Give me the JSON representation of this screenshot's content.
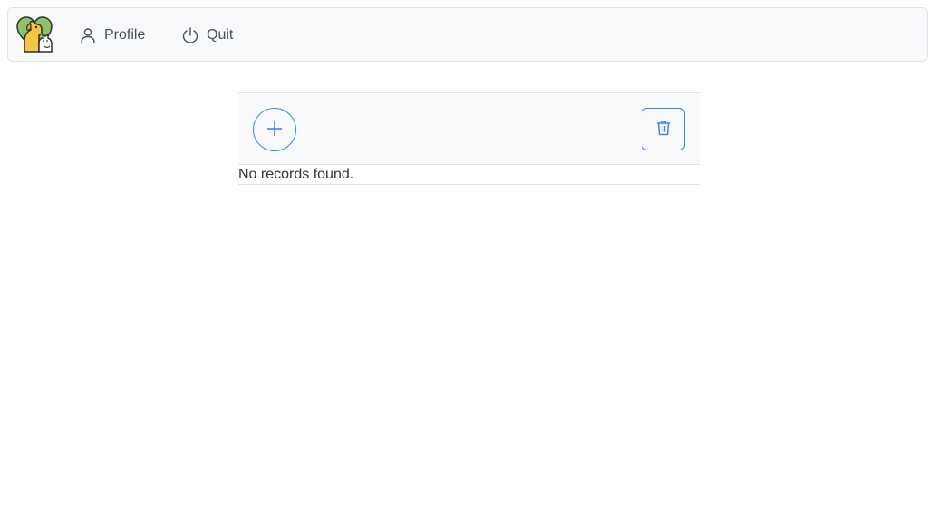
{
  "topbar": {
    "logo": {
      "icon": "dog-cat-logo-icon",
      "colors": {
        "heart": "#8fc06a",
        "dog": "#f4c542",
        "cat": "#ffffff"
      }
    },
    "menu": [
      {
        "label": "Profile",
        "icon": "user-icon"
      },
      {
        "label": "Quit",
        "icon": "power-icon"
      }
    ]
  },
  "table": {
    "toolbar": {
      "add_icon": "plus-icon",
      "delete_icon": "trash-icon"
    },
    "empty_message": "No records found."
  },
  "colors": {
    "accent": "#3b82f6",
    "toolbar_bg": "#f8f9fa",
    "border": "#dee2e6",
    "text": "#333333"
  }
}
